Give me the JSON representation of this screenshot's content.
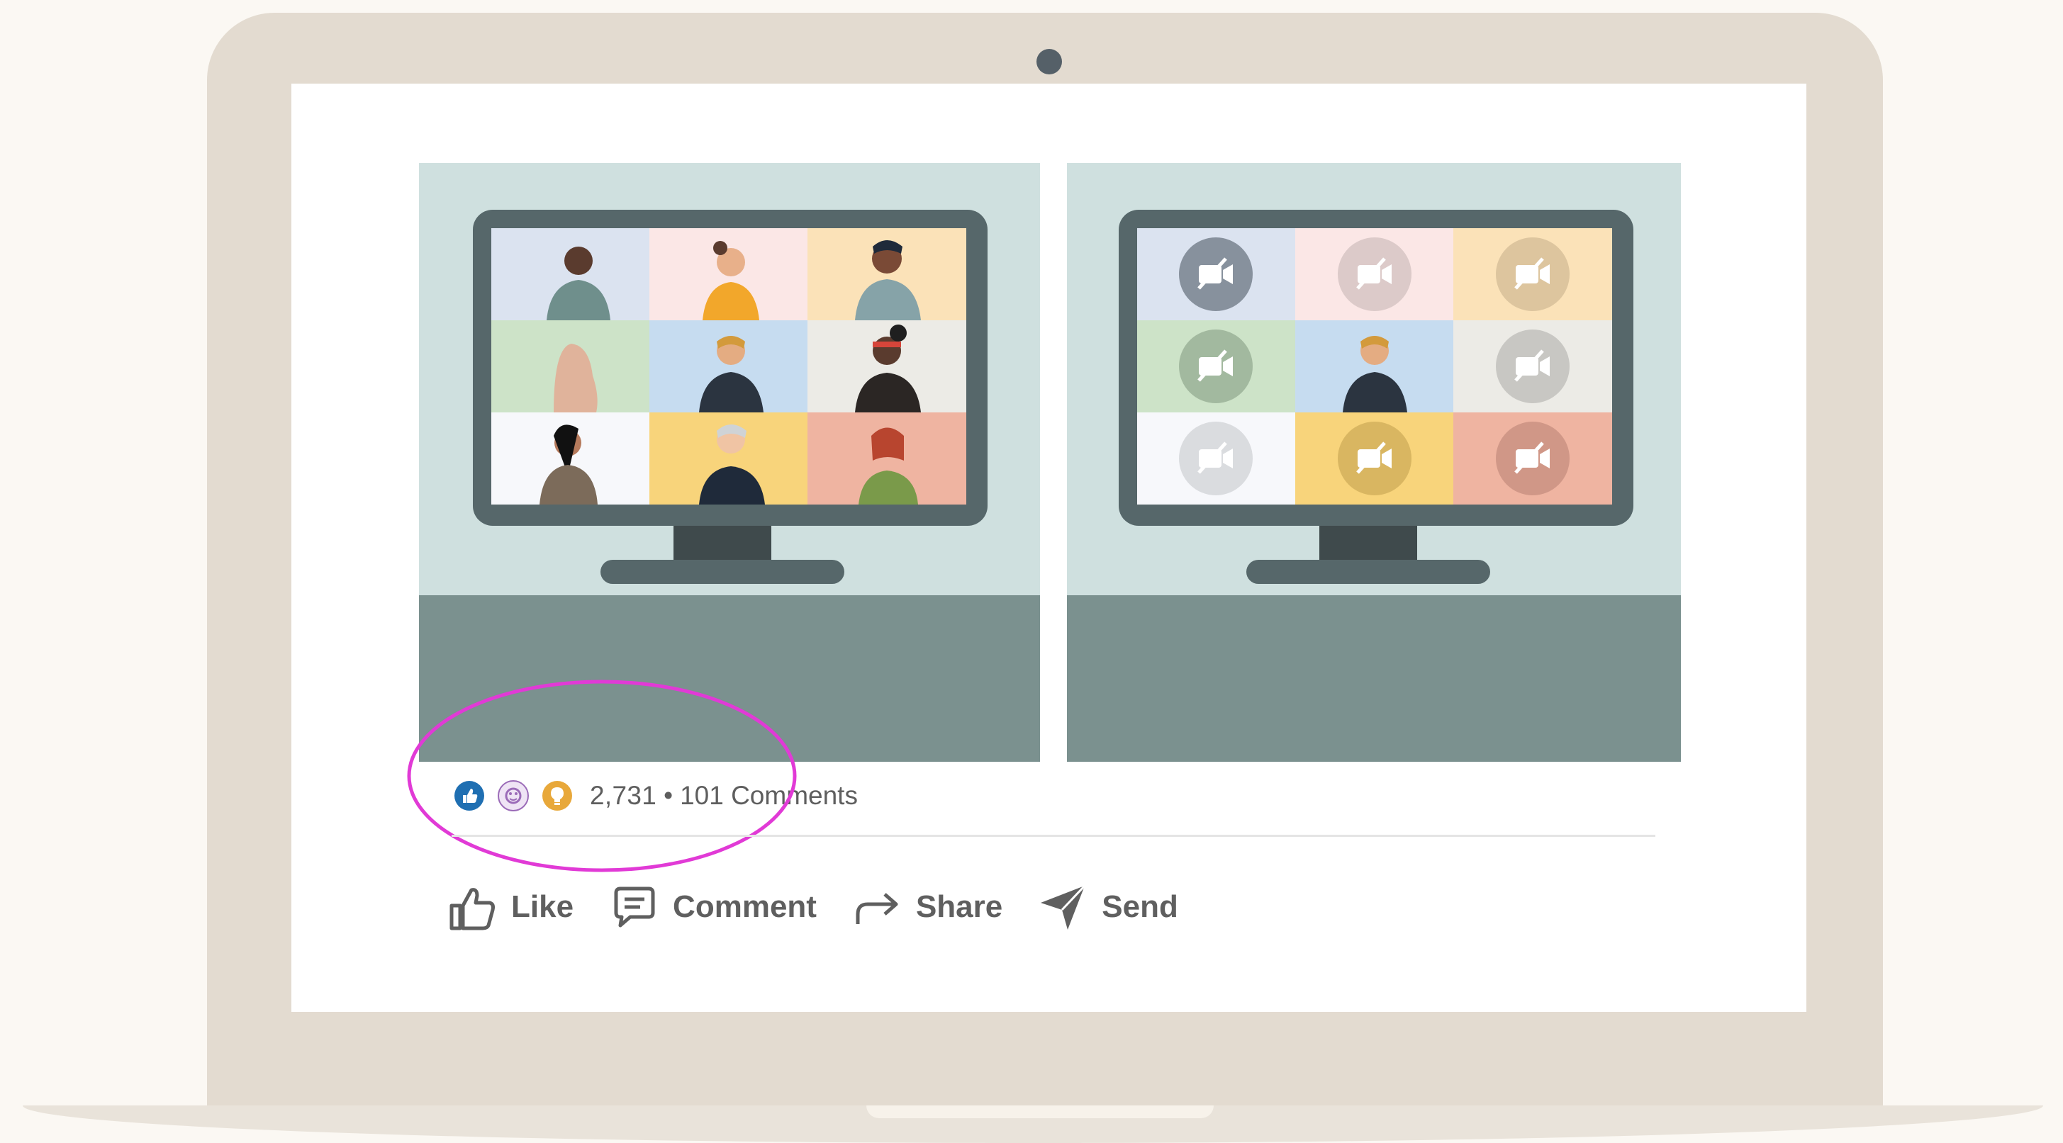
{
  "post": {
    "reactions": [
      "like-reaction-icon",
      "celebrate-reaction-icon",
      "insightful-reaction-icon"
    ],
    "reaction_count": "2,731",
    "separator": "•",
    "comments_count": "101 Comments"
  },
  "actions": {
    "like": "Like",
    "comment": "Comment",
    "share": "Share",
    "send": "Send"
  },
  "images": {
    "left": "video-call-cameras-on-illustration",
    "right": "video-call-cameras-off-illustration"
  },
  "colors": {
    "highlight": "#e13ad6",
    "like_blue": "#1f6fb2",
    "insightful_gold": "#e8a83a",
    "celebrate_purple": "#9b6bb8"
  }
}
